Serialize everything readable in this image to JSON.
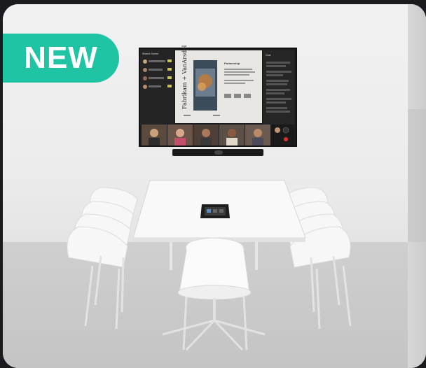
{
  "badge": {
    "label": "NEW"
  },
  "screen": {
    "side_panel_title": "Shared Screen",
    "participant_names": [
      "Shailesh Dhawan",
      "Sofia Ortiz",
      "Jordan Kay",
      "Ray Chen"
    ],
    "slide_title": "Fabrikam + VanArsdel",
    "slide_heading": "Partnership",
    "chat_title": "Chat"
  },
  "colors": {
    "badge": "#1ec4a4",
    "screen_bg": "#1e1e1e",
    "slide_bg": "#e8e6e2"
  }
}
